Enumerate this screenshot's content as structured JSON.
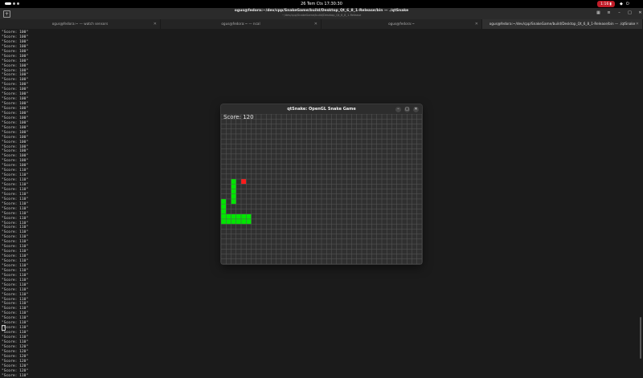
{
  "topbar": {
    "clock": "26 Tem Cts  17:30:30",
    "battery": "1:16"
  },
  "terminal_header": {
    "title": "ogus@fedora:~/dev/cpp/SnakeGame/build/Desktop_Qt_6_8_1-Release/bin — ./qtSnake",
    "subtitle": "~/dev/cpp/SnakeGame/build/Desktop_Qt_6_8_1-Release"
  },
  "tabs": [
    {
      "label": "ogus@fedora:~ — watch sensors"
    },
    {
      "label": "ogus@fedora:~ — ncal"
    },
    {
      "label": "ogus@fedora:~"
    },
    {
      "label": "ogus@fedora:~/dev/cpp/SnakeGame/build/Desktop_Qt_6_8_1-Release/bin — ./qtSnake"
    }
  ],
  "terminal": {
    "lines": [
      "\"Score: 100\"",
      "\"Score: 100\"",
      "\"Score: 100\"",
      "\"Score: 100\"",
      "\"Score: 100\"",
      "\"Score: 100\"",
      "\"Score: 100\"",
      "\"Score: 100\"",
      "\"Score: 100\"",
      "\"Score: 100\"",
      "\"Score: 100\"",
      "\"Score: 100\"",
      "\"Score: 100\"",
      "\"Score: 100\"",
      "\"Score: 100\"",
      "\"Score: 100\"",
      "\"Score: 100\"",
      "\"Score: 100\"",
      "\"Score: 100\"",
      "\"Score: 100\"",
      "\"Score: 100\"",
      "\"Score: 100\"",
      "\"Score: 100\"",
      "\"Score: 100\"",
      "\"Score: 100\"",
      "\"Score: 100\"",
      "\"Score: 100\"",
      "\"Score: 100\"",
      "\"Score: 100\"",
      "\"Score: 110\"",
      "\"Score: 110\"",
      "\"Score: 110\"",
      "\"Score: 110\"",
      "\"Score: 110\"",
      "\"Score: 110\"",
      "\"Score: 110\"",
      "\"Score: 110\"",
      "\"Score: 110\"",
      "\"Score: 110\"",
      "\"Score: 110\"",
      "\"Score: 110\"",
      "\"Score: 110\"",
      "\"Score: 110\"",
      "\"Score: 110\"",
      "\"Score: 110\"",
      "\"Score: 110\"",
      "\"Score: 110\"",
      "\"Score: 110\"",
      "\"Score: 110\"",
      "\"Score: 110\"",
      "\"Score: 110\"",
      "\"Score: 110\"",
      "\"Score: 110\"",
      "\"Score: 110\"",
      "\"Score: 110\"",
      "\"Score: 110\"",
      "\"Score: 110\"",
      "\"Score: 110\"",
      "\"Score: 110\"",
      "\"Score: 110\"",
      "\"Score: 110\"",
      "\"Score: 110\"",
      "\"Score: 110\"",
      "\"Score: 110\"",
      "\"Score: 110\"",
      "\"Score: 110\"",
      "\"Score: 120\"",
      "\"Score: 120\"",
      "\"Score: 120\"",
      "\"Score: 120\"",
      "\"Score: 120\"",
      "\"Score: 120\"",
      "\"Score: 110\""
    ]
  },
  "game": {
    "window_title": "qtSnake: OpenGL Snake Game",
    "score_text": "Score: 120",
    "grid_cols": 40,
    "grid_rows": 30,
    "snake_cells": [
      [
        2,
        13
      ],
      [
        2,
        14
      ],
      [
        2,
        15
      ],
      [
        2,
        16
      ],
      [
        2,
        17
      ],
      [
        0,
        17
      ],
      [
        0,
        18
      ],
      [
        0,
        19
      ],
      [
        0,
        20
      ],
      [
        1,
        20
      ],
      [
        2,
        20
      ],
      [
        3,
        20
      ],
      [
        4,
        20
      ],
      [
        1,
        21
      ],
      [
        2,
        21
      ],
      [
        3,
        21
      ],
      [
        4,
        21
      ],
      [
        5,
        21
      ],
      [
        5,
        20
      ],
      [
        4,
        21
      ],
      [
        3,
        21
      ],
      [
        0,
        21
      ],
      [
        1,
        21
      ]
    ],
    "food_cell": [
      4,
      13
    ],
    "colors": {
      "background": "#303030",
      "grid": "#595959",
      "snake": "#00e600",
      "food": "#ff1a1a"
    }
  }
}
